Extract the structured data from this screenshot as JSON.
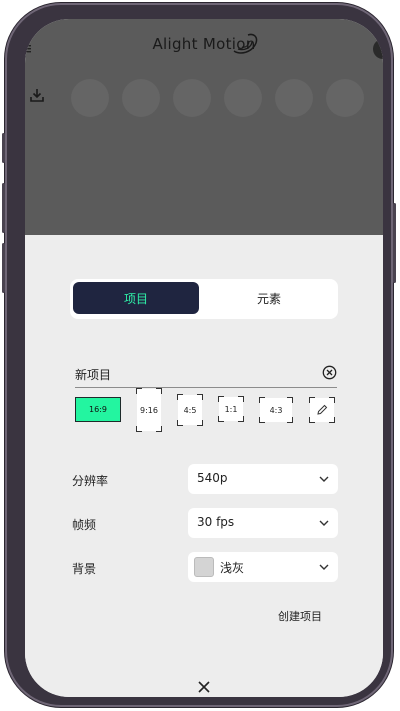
{
  "app": {
    "title": "Alight Motion"
  },
  "icons": {
    "menu": "menu-icon",
    "download": "download-icon",
    "clear": "clear-circle-icon",
    "chevron": "chevron-down-icon",
    "pencil": "pencil-icon",
    "close": "close-icon"
  },
  "tabs": [
    {
      "label": "项目",
      "active": true
    },
    {
      "label": "元素",
      "active": false
    }
  ],
  "project": {
    "name": "新项目"
  },
  "ratios": [
    {
      "label": "16:9",
      "selected": true
    },
    {
      "label": "9:16",
      "selected": false
    },
    {
      "label": "4:5",
      "selected": false
    },
    {
      "label": "1:1",
      "selected": false
    },
    {
      "label": "4:3",
      "selected": false
    }
  ],
  "settings": {
    "resolution": {
      "label": "分辨率",
      "value": "540p"
    },
    "framerate": {
      "label": "帧频",
      "value": "30 fps"
    },
    "background": {
      "label": "背景",
      "value": "浅灰",
      "swatch_color": "#d4d4d4"
    }
  },
  "actions": {
    "create": "创建项目"
  },
  "colors": {
    "accent": "#23f5a0",
    "tab_active_bg": "#1f2540",
    "overlay": "#5b5b5b"
  }
}
